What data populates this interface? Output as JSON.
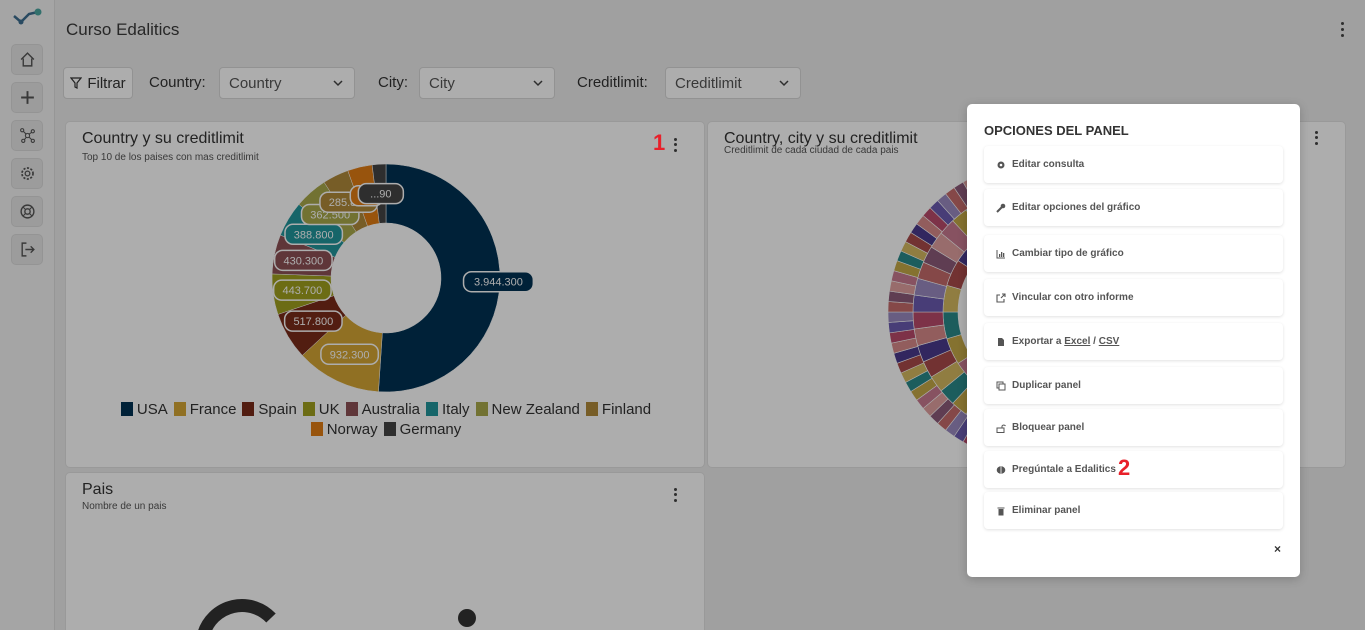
{
  "app": {
    "title": "Curso Edalitics"
  },
  "sidebar": {
    "items": [
      {
        "name": "home",
        "icon": "home-icon"
      },
      {
        "name": "add",
        "icon": "plus-icon"
      },
      {
        "name": "network",
        "icon": "network-icon"
      },
      {
        "name": "settings",
        "icon": "gear-icon"
      },
      {
        "name": "help",
        "icon": "lifebuoy-icon"
      },
      {
        "name": "logout",
        "icon": "logout-icon"
      }
    ]
  },
  "filters": {
    "filter_label": "Filtrar",
    "country": {
      "label": "Country:",
      "value": "Country"
    },
    "city": {
      "label": "City:",
      "value": "City"
    },
    "creditlimit": {
      "label": "Creditlimit:",
      "value": "Creditlimit"
    }
  },
  "panel1": {
    "title": "Country y su creditlimit",
    "subtitle": "Top 10 de los paises con mas creditlimit",
    "marker": "1"
  },
  "panel2": {
    "title": "Country, city y su creditlimit",
    "subtitle": "Creditlimit de cada ciudad de cada pais"
  },
  "panel3": {
    "title": "Pais",
    "subtitle": "Nombre de un pais"
  },
  "chart_data": {
    "type": "pie",
    "donut": true,
    "categories": [
      "USA",
      "France",
      "Spain",
      "UK",
      "Australia",
      "Italy",
      "New Zealand",
      "Finland",
      "Norway",
      "Germany"
    ],
    "values": [
      3944300,
      932300,
      517800,
      443700,
      430300,
      388800,
      362500,
      285800,
      0,
      0
    ],
    "data_labels": [
      "3.944.300",
      "932.300",
      "517.800",
      "443.700",
      "430.300",
      "388.800",
      "362.500",
      "285.800",
      "...",
      "...90"
    ],
    "colors": [
      "#003153",
      "#d4a534",
      "#7a2c1a",
      "#a0a01e",
      "#8c5055",
      "#21969b",
      "#a8a84a",
      "#b08a3a",
      "#e07c14",
      "#454545"
    ],
    "legend_position": "bottom"
  },
  "chart_data_visual_values": [
    3944300,
    932300,
    517800,
    443700,
    430300,
    388800,
    362500,
    285800,
    270000,
    150000
  ],
  "modal": {
    "title": "OPCIONES DEL PANEL",
    "options": [
      {
        "icon": "gear-icon",
        "label": "Editar consulta"
      },
      {
        "icon": "wrench-icon",
        "label": "Editar opciones del gráfico"
      },
      {
        "icon": "bar-chart-icon",
        "label": "Cambiar tipo de gráfico"
      },
      {
        "icon": "external-link-icon",
        "label": "Vincular con otro informe"
      },
      {
        "icon": "file-icon",
        "label_prefix": "Exportar a ",
        "excel": "Excel",
        "sep": " / ",
        "csv": "CSV"
      },
      {
        "icon": "copy-icon",
        "label": "Duplicar panel"
      },
      {
        "icon": "unlock-icon",
        "label": "Bloquear panel"
      },
      {
        "icon": "brain-icon",
        "label": "Pregúntale a Edalitics"
      },
      {
        "icon": "trash-icon",
        "label": "Eliminar panel"
      }
    ],
    "marker": "2",
    "close": "×"
  },
  "colors": {
    "accent": "#e8202a",
    "overlay": "rgba(0,0,0,0.32)"
  }
}
